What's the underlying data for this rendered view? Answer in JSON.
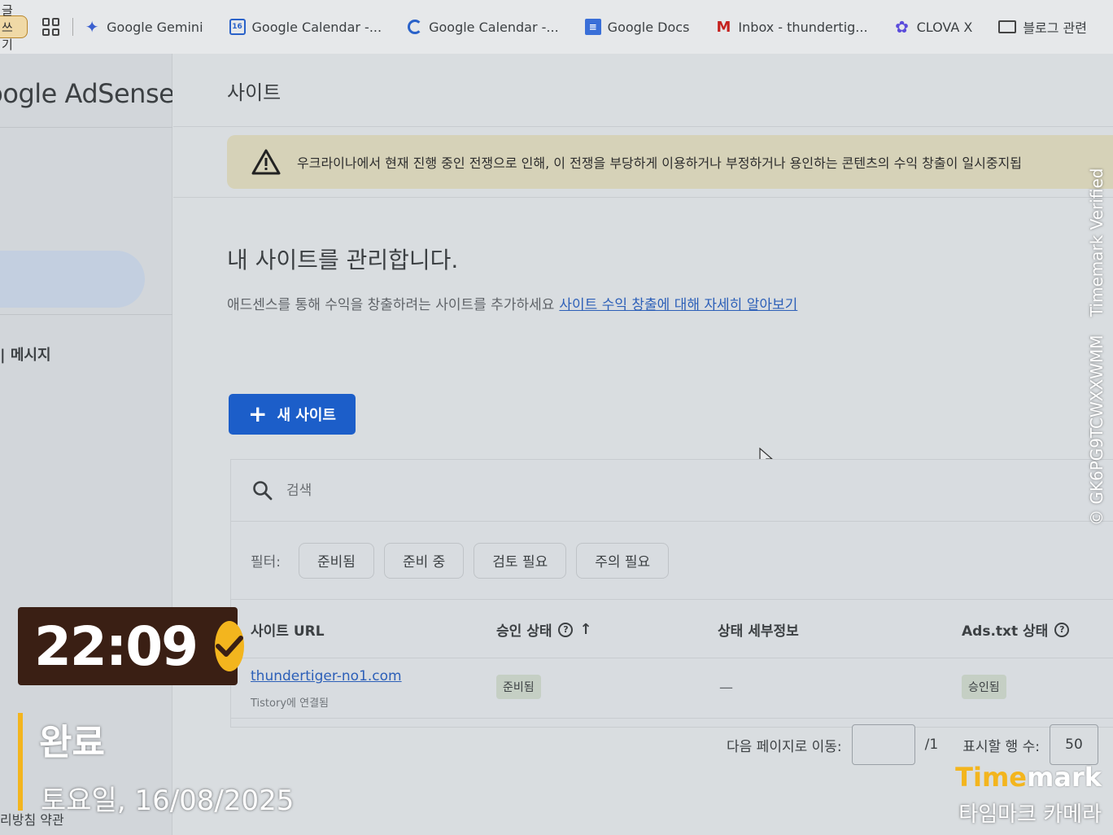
{
  "bookmarks": {
    "write_label": "글쓰기",
    "items": [
      {
        "label": "Google Gemini",
        "icon": "gemini-icon"
      },
      {
        "label": "Google Calendar -...",
        "icon": "calendar-icon"
      },
      {
        "label": "Google Calendar -...",
        "icon": "calendar-sync-icon"
      },
      {
        "label": "Google Docs",
        "icon": "docs-icon"
      },
      {
        "label": "Inbox - thundertig...",
        "icon": "gmail-icon"
      },
      {
        "label": "CLOVA X",
        "icon": "clova-icon"
      },
      {
        "label": "블로그 관련",
        "icon": "folder-icon"
      }
    ]
  },
  "nav": {
    "brand": "Google AdSense",
    "messages_label": "| 메시지",
    "footer": "리방침  약관"
  },
  "main": {
    "page_title": "사이트",
    "alert_text": "우크라이나에서 현재 진행 중인 전쟁으로 인해, 이 전쟁을 부당하게 이용하거나 부정하거나 용인하는 콘텐츠의 수익 창출이 일시중지됩",
    "manage_title": "내 사이트를 관리합니다.",
    "manage_desc": "애드센스를 통해 수익을 창출하려는 사이트를 추가하세요",
    "learn_more_link": "사이트 수익 창출에 대해 자세히 알아보기",
    "new_site_label": "새 사이트",
    "search_placeholder": "검색",
    "filter_label": "필터:",
    "filters": [
      "준비됨",
      "준비 중",
      "검토 필요",
      "주의 필요"
    ],
    "columns": {
      "site_url": "사이트 URL",
      "approval": "승인 상태",
      "details": "상태 세부정보",
      "ads_txt": "Ads.txt 상태"
    },
    "rows": [
      {
        "site_url": "thundertiger-no1.com",
        "sub": "Tistory에 연결됨",
        "approval": "준비됨",
        "details": "—",
        "ads_txt": "승인됨"
      }
    ],
    "pager": {
      "goto_label": "다음 페이지로 이동:",
      "goto_value": "",
      "total": "/1",
      "rows_label": "표시할 행 수:",
      "rows_value": "50"
    }
  },
  "overlay": {
    "time": "22:09",
    "status": "완료",
    "date": "토요일, 16/08/2025",
    "brand_part1": "Time",
    "brand_part2": "mark",
    "brand_sub": "타임마크 카메라",
    "verified_code": "GK6PG9TCWXXWMM",
    "verified_label": "Timemark Verified",
    "accent_color": "#f3b51e"
  }
}
